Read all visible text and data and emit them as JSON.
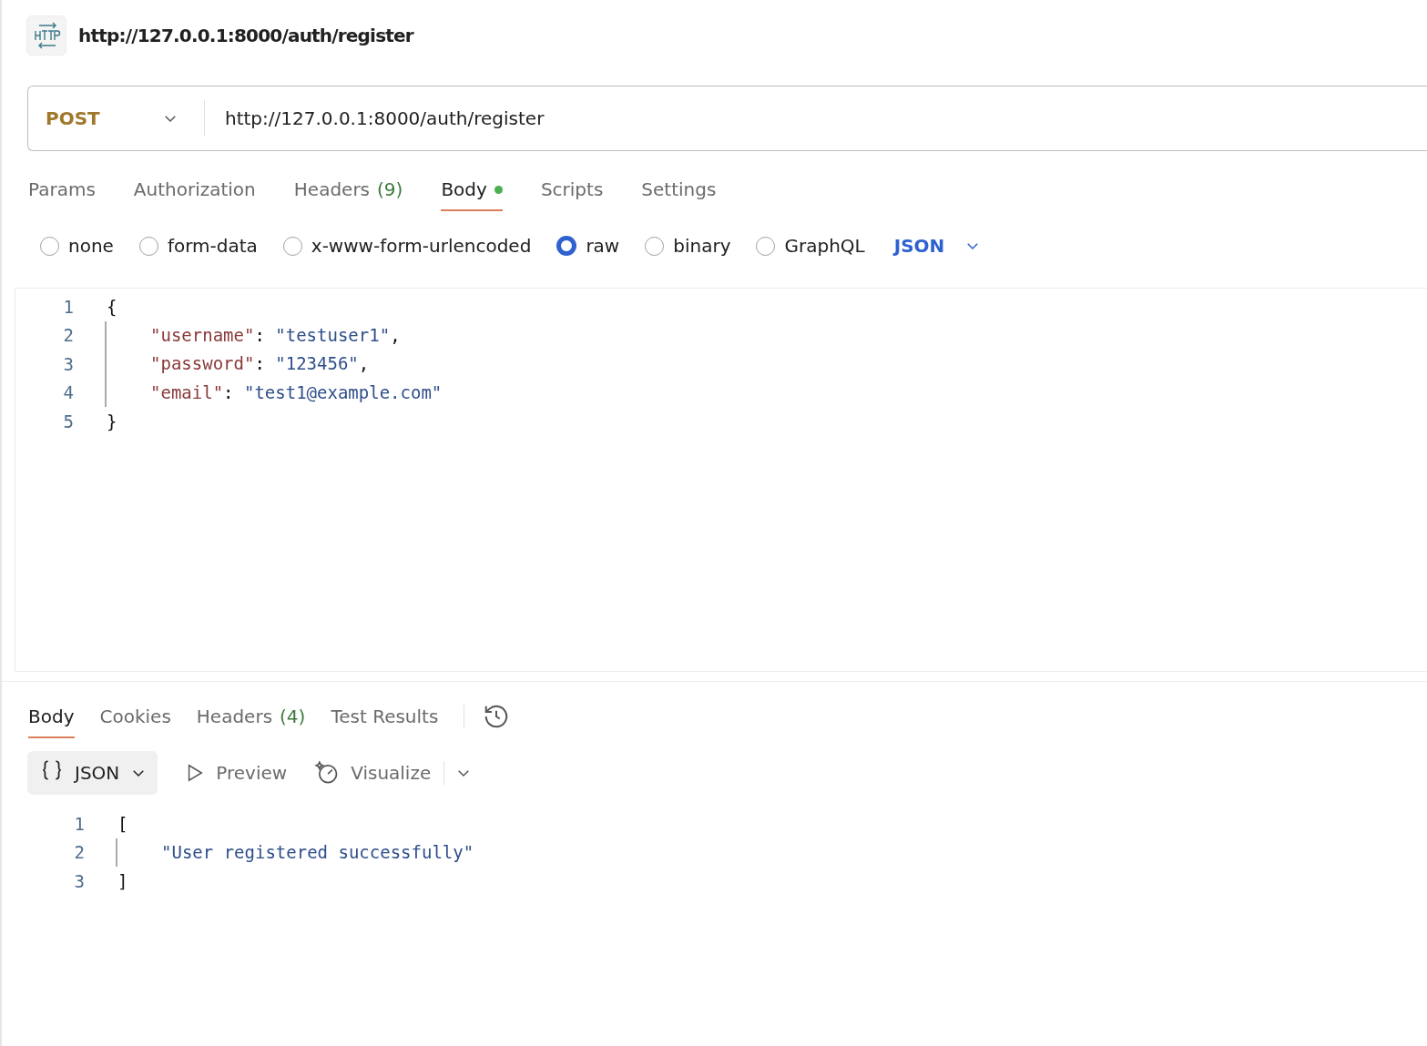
{
  "request": {
    "title": "http://127.0.0.1:8000/auth/register",
    "method": "POST",
    "url": "http://127.0.0.1:8000/auth/register"
  },
  "request_tabs": [
    {
      "label": "Params",
      "selected": false
    },
    {
      "label": "Authorization",
      "selected": false
    },
    {
      "label": "Headers",
      "count": "(9)",
      "selected": false
    },
    {
      "label": "Body",
      "dot": true,
      "selected": true
    },
    {
      "label": "Scripts",
      "selected": false
    },
    {
      "label": "Settings",
      "selected": false
    }
  ],
  "body_types": [
    {
      "label": "none",
      "selected": false
    },
    {
      "label": "form-data",
      "selected": false
    },
    {
      "label": "x-www-form-urlencoded",
      "selected": false
    },
    {
      "label": "raw",
      "selected": true
    },
    {
      "label": "binary",
      "selected": false
    },
    {
      "label": "GraphQL",
      "selected": false
    }
  ],
  "body_format": "JSON",
  "request_body": [
    {
      "number": "1",
      "tokens": [
        {
          "kind": "punct",
          "text": "{"
        }
      ],
      "children": [
        {
          "number": "2",
          "tokens": [
            {
              "kind": "key",
              "text": "\"username\""
            },
            {
              "kind": "punct",
              "text": ": "
            },
            {
              "kind": "string",
              "text": "\"testuser1\""
            },
            {
              "kind": "punct",
              "text": ","
            }
          ]
        },
        {
          "number": "3",
          "tokens": [
            {
              "kind": "key",
              "text": "\"password\""
            },
            {
              "kind": "punct",
              "text": ": "
            },
            {
              "kind": "string",
              "text": "\"123456\""
            },
            {
              "kind": "punct",
              "text": ","
            }
          ]
        },
        {
          "number": "4",
          "tokens": [
            {
              "kind": "key",
              "text": "\"email\""
            },
            {
              "kind": "punct",
              "text": ": "
            },
            {
              "kind": "string",
              "text": "\"test1@example.com\""
            }
          ]
        }
      ]
    },
    {
      "number": "5",
      "tokens": [
        {
          "kind": "punct",
          "text": "}"
        }
      ]
    }
  ],
  "response_tabs": [
    {
      "label": "Body",
      "selected": true
    },
    {
      "label": "Cookies",
      "selected": false
    },
    {
      "label": "Headers",
      "count": "(4)",
      "selected": false
    },
    {
      "label": "Test Results",
      "selected": false
    }
  ],
  "response_views": [
    {
      "kind": "format",
      "label": "JSON",
      "selected": true
    },
    {
      "kind": "preview",
      "label": "Preview",
      "selected": false
    },
    {
      "kind": "visualize",
      "label": "Visualize",
      "selected": false
    }
  ],
  "response_body": [
    {
      "number": "1",
      "tokens": [
        {
          "kind": "punct",
          "text": "["
        }
      ],
      "children": [
        {
          "number": "2",
          "tokens": [
            {
              "kind": "string",
              "text": "\"User registered successfully\""
            }
          ]
        }
      ]
    },
    {
      "number": "3",
      "tokens": [
        {
          "kind": "punct",
          "text": "]"
        }
      ]
    }
  ]
}
